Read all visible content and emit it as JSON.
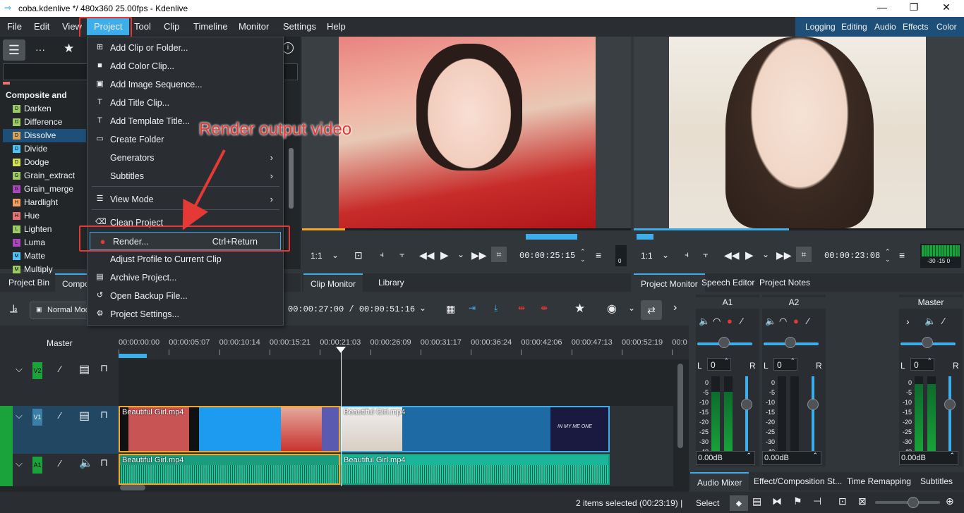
{
  "window": {
    "title": "coba.kdenlive */ 480x360 25.00fps - Kdenlive",
    "minimize": "—",
    "maximize": "❐",
    "close": "✕"
  },
  "menu": [
    "File",
    "Edit",
    "View",
    "Project",
    "Tool",
    "Clip",
    "Timeline",
    "Monitor",
    "Settings",
    "Help"
  ],
  "workspaces": [
    "Logging",
    "Editing",
    "Audio",
    "Effects",
    "Color"
  ],
  "project_menu": {
    "items": [
      {
        "label": "Add Clip or Folder...",
        "icon": "add-clip-icon"
      },
      {
        "label": "Add Color Clip...",
        "icon": "color-clip-icon"
      },
      {
        "label": "Add Image Sequence...",
        "icon": "image-sequence-icon"
      },
      {
        "label": "Add Title Clip...",
        "icon": "title-clip-icon"
      },
      {
        "label": "Add Template Title...",
        "icon": "template-title-icon"
      },
      {
        "label": "Create Folder",
        "icon": "folder-icon"
      },
      {
        "label": "Generators",
        "icon": ""
      },
      {
        "label": "Subtitles",
        "icon": ""
      },
      {
        "label": "View Mode",
        "icon": "view-mode-icon"
      },
      {
        "label": "Clean Project",
        "icon": "clean-icon"
      },
      {
        "label": "Render...",
        "icon": "render-icon",
        "shortcut": "Ctrl+Return"
      },
      {
        "label": "Adjust Profile to Current Clip",
        "icon": ""
      },
      {
        "label": "Archive Project...",
        "icon": "archive-icon"
      },
      {
        "label": "Open Backup File...",
        "icon": "backup-icon"
      },
      {
        "label": "Project Settings...",
        "icon": "settings-icon"
      }
    ]
  },
  "annotation": {
    "text": "Render output video",
    "color": "#e53935"
  },
  "effects_list": {
    "group": "Composite and",
    "items": [
      {
        "label": "Darken",
        "letter": "D",
        "color": "#9ccc65"
      },
      {
        "label": "Difference",
        "letter": "D",
        "color": "#9ccc65"
      },
      {
        "label": "Dissolve",
        "letter": "D",
        "color": "#d6a45b",
        "selected": true
      },
      {
        "label": "Divide",
        "letter": "D",
        "color": "#4fc3f7"
      },
      {
        "label": "Dodge",
        "letter": "D",
        "color": "#d4e157"
      },
      {
        "label": "Grain_extract",
        "letter": "G",
        "color": "#9ccc65"
      },
      {
        "label": "Grain_merge",
        "letter": "G",
        "color": "#ab47bc"
      },
      {
        "label": "Hardlight",
        "letter": "H",
        "color": "#f4a261"
      },
      {
        "label": "Hue",
        "letter": "H",
        "color": "#e57373"
      },
      {
        "label": "Lighten",
        "letter": "L",
        "color": "#9ccc65"
      },
      {
        "label": "Luma",
        "letter": "L",
        "color": "#ab47bc"
      },
      {
        "label": "Matte",
        "letter": "M",
        "color": "#4fc3f7"
      },
      {
        "label": "Multiply",
        "letter": "M",
        "color": "#9ccc65"
      }
    ]
  },
  "left_tabs": [
    "Project Bin",
    "Compos"
  ],
  "clip_monitor": {
    "zoom": "1:1",
    "timecode": "00:00:25:15",
    "progress": 0.13,
    "meter": "0",
    "tabs": [
      "Clip Monitor",
      "Library"
    ]
  },
  "project_monitor": {
    "zoom": "1:1",
    "timecode": "00:00:23:08",
    "progress": 0.47,
    "meter": "-30 -15 0",
    "tabs": [
      "Project Monitor",
      "Speech Editor",
      "Project Notes"
    ]
  },
  "timeline": {
    "mode": "Normal Mod",
    "position": "00:00:27:00 / 00:00:51:16",
    "master": "Master",
    "ruler": [
      "00:00:00:00",
      "00:00:05:07",
      "00:00:10:14",
      "00:00:15:21",
      "00:00:21:03",
      "00:00:26:09",
      "00:00:31:17",
      "00:00:36:24",
      "00:00:42:06",
      "00:00:47:13",
      "00:00:52:19",
      "00:0"
    ],
    "tracks": [
      {
        "name": "V2",
        "type": "video"
      },
      {
        "name": "V1",
        "type": "video"
      },
      {
        "name": "A1",
        "type": "audio"
      }
    ],
    "clips": [
      {
        "label": "Beautiful Girl.mp4",
        "track": "V1"
      },
      {
        "label": "Beautiful Girl.mp4",
        "track": "V1"
      },
      {
        "label": "Beautiful Girl.mp4",
        "track": "A1"
      },
      {
        "label": "Beautiful Girl.mp4",
        "track": "A1"
      }
    ],
    "thumb_texts": [
      "IN MY ME ONE"
    ]
  },
  "mixer": {
    "channels": [
      {
        "name": "A1",
        "pan": "0",
        "db": "0.00dB",
        "level": 0.8
      },
      {
        "name": "A2",
        "pan": "0",
        "db": "0.00dB",
        "level": 0
      },
      {
        "name": "Master",
        "pan": "0",
        "db": "0.00dB",
        "level": 0.9
      }
    ],
    "scale": [
      "0",
      "-5",
      "-10",
      "-15",
      "-20",
      "-25",
      "-30",
      "-40"
    ],
    "lr": [
      "L",
      "R"
    ],
    "tabs": [
      "Audio Mixer",
      "Effect/Composition St...",
      "Time Remapping",
      "Subtitles"
    ]
  },
  "statusbar": {
    "selection": "2 items selected (00:23:19)  |",
    "tool": "Select"
  }
}
